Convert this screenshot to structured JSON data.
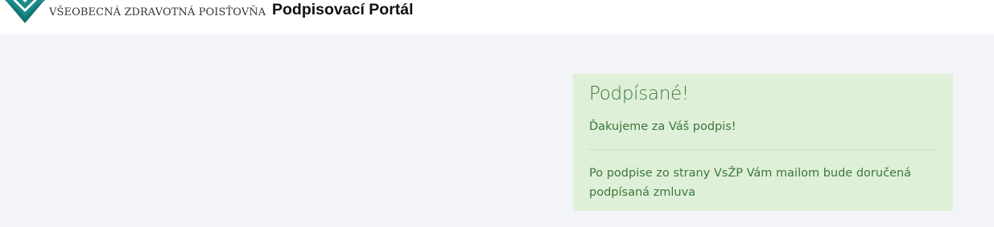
{
  "header": {
    "logo": {
      "icon": "vszp-chevron-logo-icon",
      "text": "VŠEOBECNÁ ZDRAVOTNÁ POISŤOVŇA",
      "color": "#1a8a8a"
    },
    "title": "Podpisovací Portál"
  },
  "alert": {
    "type": "success",
    "heading": "Podpísané!",
    "thanks": "Ďakujeme za Váš podpis!",
    "note": "Po podpise zo strany VsŽP Vám mailom bude doručená podpísaná zmluva",
    "background": "#dff0d8",
    "text_color": "#3c763d"
  }
}
